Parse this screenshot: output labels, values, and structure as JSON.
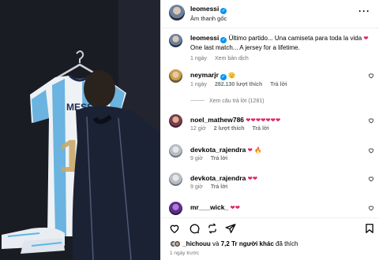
{
  "post": {
    "username": "leomessi",
    "audio": "Âm thanh gốc"
  },
  "caption": {
    "username": "leomessi",
    "text_es": "Último partido... Una camiseta para toda la vida",
    "text_en": "One last match... A jersey for a lifetime.",
    "heart": "❤",
    "time": "1 ngày",
    "translate": "Xem bản dịch"
  },
  "comments": [
    {
      "username": "neymarjr",
      "verified": true,
      "text": "🫡",
      "time": "1 ngày",
      "likes": "282.130 lượt thích",
      "reply": "Trả lời",
      "thread": "Xem câu trả lời (1281)"
    },
    {
      "username": "noel_mathew786",
      "verified": false,
      "text": "❤❤❤❤❤❤❤",
      "time": "12 giờ",
      "likes": "2 lượt thích",
      "reply": "Trả lời"
    },
    {
      "username": "devkota_rajendra",
      "verified": false,
      "text": "❤ 🔥",
      "time": "9 giờ",
      "reply": "Trả lời"
    },
    {
      "username": "devkota_rajendra",
      "verified": false,
      "text": "❤❤",
      "time": "9 giờ",
      "reply": "Trả lời"
    },
    {
      "username": "mr___wick_",
      "verified": false,
      "text": "❤❤",
      "time": "",
      "reply": ""
    }
  ],
  "actions": {
    "liked_by_user": "_hichouu",
    "liked_by_joiner": "và",
    "liked_by_others": "7,2 Tr người khác",
    "liked_suffix": "đã thích",
    "posted_ago": "1 ngày trước"
  },
  "media": {
    "jersey_number": "10",
    "jersey_name": "MESSI"
  },
  "colors": {
    "verified": "#0095f6",
    "heart": "#e0245e",
    "muted": "#737373",
    "jersey_blue": "#6bb3e0"
  }
}
